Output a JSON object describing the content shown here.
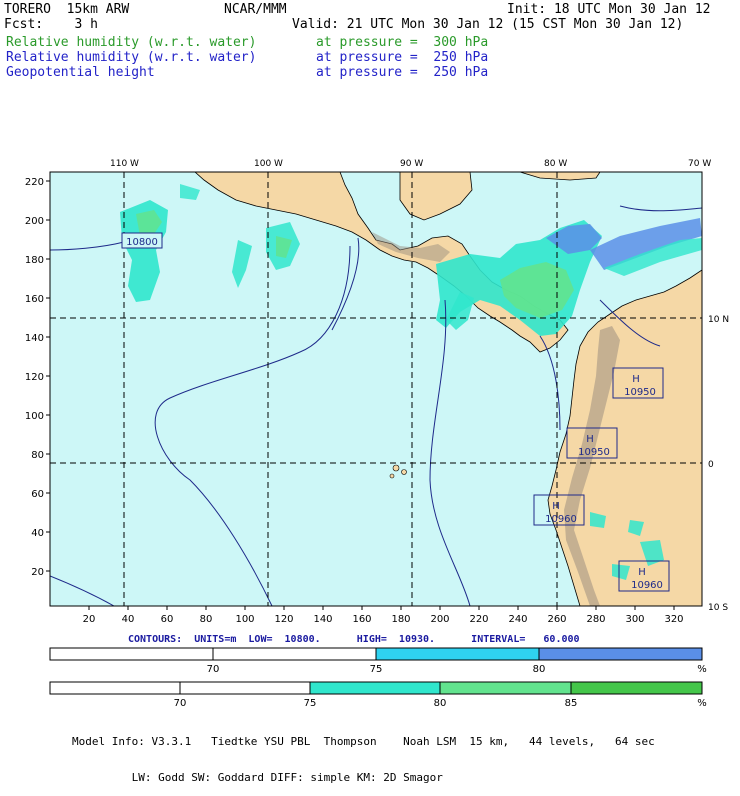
{
  "header": {
    "model": "TORERO  15km ARW",
    "org": "NCAR/MMM",
    "init": "Init: 18 UTC Mon 30 Jan 12",
    "fcst": "Fcst:    3 h",
    "valid": "Valid: 21 UTC Mon 30 Jan 12 (15 CST Mon 30 Jan 12)",
    "fields": [
      {
        "name": "Relative humidity (w.r.t. water)",
        "level": "at pressure =  300 hPa",
        "color": "#2a9a2a"
      },
      {
        "name": "Relative humidity (w.r.t. water)",
        "level": "at pressure =  250 hPa",
        "color": "#2323c8"
      },
      {
        "name": "Geopotential height",
        "level": "at pressure =  250 hPa",
        "color": "#000000"
      }
    ]
  },
  "map": {
    "lon_labels": [
      "110 W",
      "100 W",
      "90 W",
      "80 W",
      "70 W"
    ],
    "lat_labels": [
      "10 N",
      "0",
      "10 S"
    ],
    "x_ticks": [
      "20",
      "40",
      "60",
      "80",
      "100",
      "120",
      "140",
      "160",
      "180",
      "200",
      "220",
      "240",
      "260",
      "280",
      "300",
      "320"
    ],
    "y_ticks": [
      "220",
      "200",
      "180",
      "160",
      "140",
      "120",
      "100",
      "80",
      "60",
      "40",
      "20"
    ],
    "height_labels": [
      {
        "type": "L",
        "value": "10800"
      },
      {
        "type": "H",
        "value": "10950"
      },
      {
        "type": "H",
        "value": "10950"
      },
      {
        "type": "H",
        "value": "10960"
      },
      {
        "type": "H",
        "value": "10960"
      }
    ],
    "colors": {
      "ocean": "#cdf7f7",
      "land": "#f5d8a6",
      "terrain": "#9c8f80"
    }
  },
  "contours_line": "CONTOURS:  UNITS=m  LOW=  10800.      HIGH=  10930.      INTERVAL=   60.000",
  "colorbars": [
    {
      "stops": [
        "70",
        "75",
        "80"
      ],
      "unit": "%",
      "segments": [
        {
          "color": "#ffffff"
        },
        {
          "color": "#ffffff"
        },
        {
          "color": "#2fd2f0"
        },
        {
          "color": "#5a8fe8"
        }
      ]
    },
    {
      "stops": [
        "70",
        "75",
        "80",
        "85"
      ],
      "unit": "%",
      "segments": [
        {
          "color": "#ffffff"
        },
        {
          "color": "#ffffff"
        },
        {
          "color": "#30e6cc"
        },
        {
          "color": "#62e38e"
        },
        {
          "color": "#44c64a"
        }
      ]
    }
  ],
  "model_info": [
    "Model Info: V3.3.1   Tiedtke YSU PBL  Thompson    Noah LSM  15 km,   44 levels,   64 sec",
    "         LW: Godd SW: Goddard DIFF: simple KM: 2D Smagor"
  ]
}
